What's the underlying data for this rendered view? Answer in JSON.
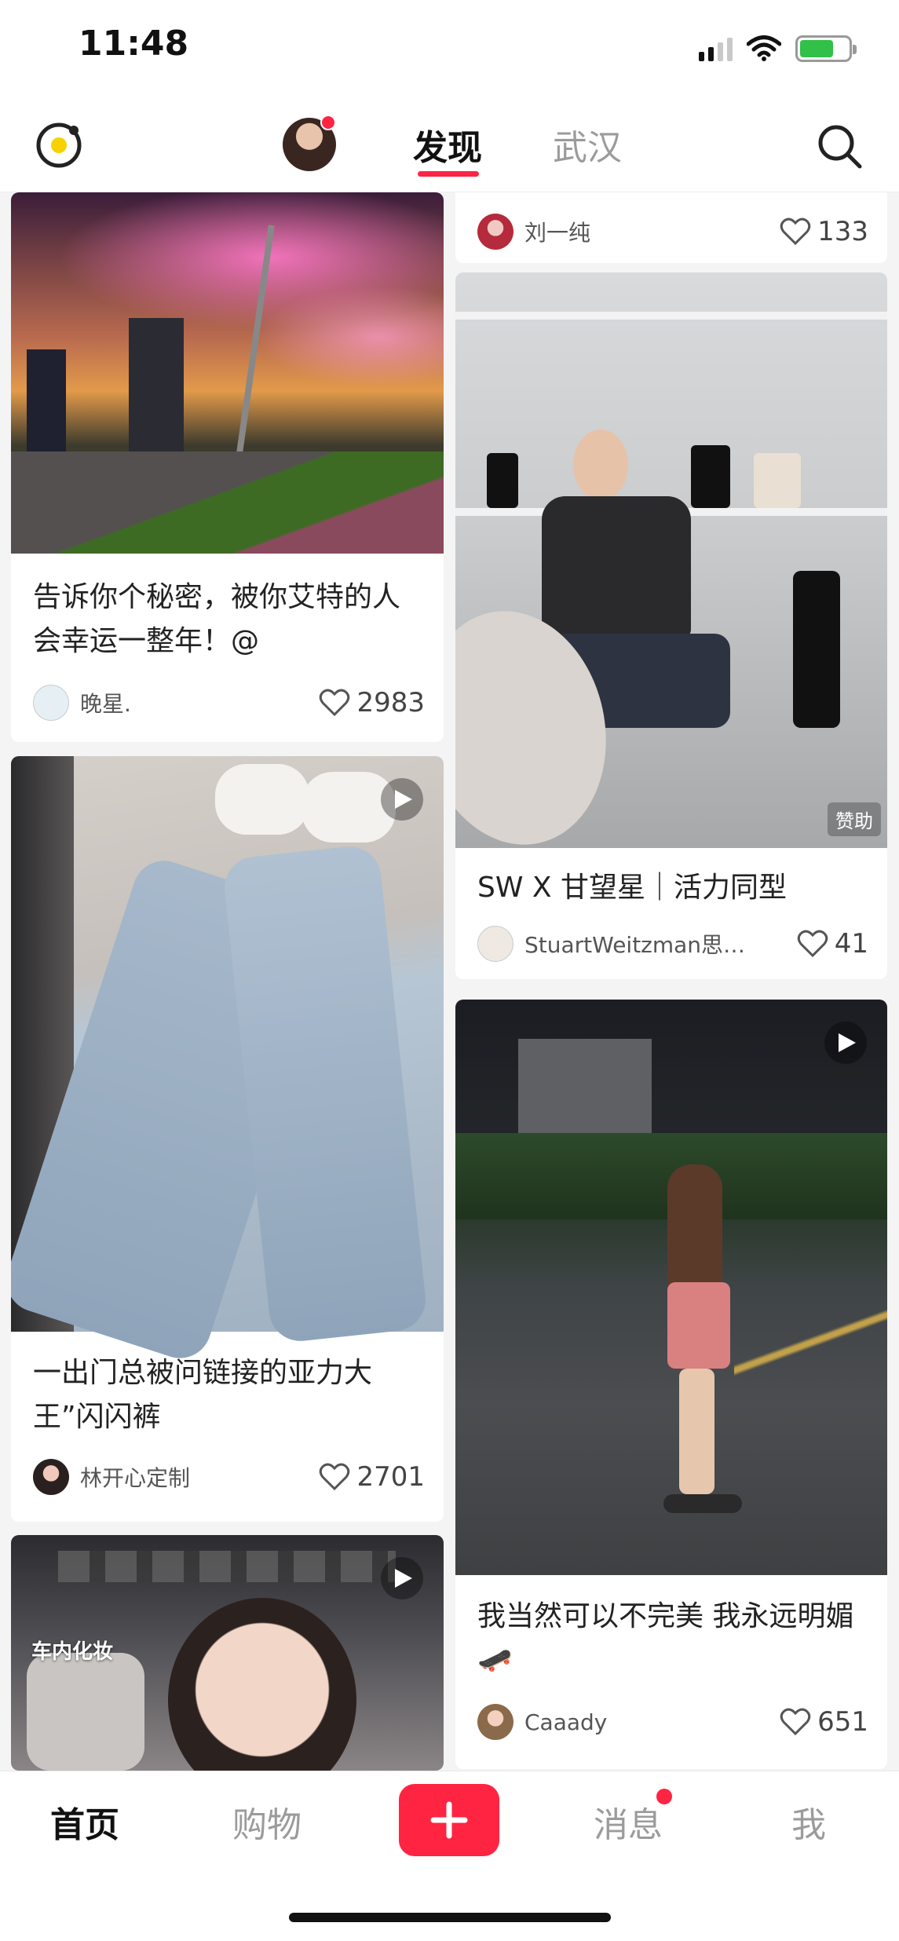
{
  "status_bar": {
    "time": "11:48"
  },
  "top_nav": {
    "tabs": [
      {
        "label": "发现",
        "active": true
      },
      {
        "label": "武汉",
        "active": false
      }
    ]
  },
  "feed": {
    "cards": [
      {
        "id": "c0",
        "title": "",
        "author": "刘一纯",
        "likes": "133"
      },
      {
        "id": "c1",
        "title": "告诉你个秘密，被你艾特的人会幸运一整年！@",
        "author": "晚星.",
        "likes": "2983"
      },
      {
        "id": "c2",
        "title": "SW X 甘望星｜活力同型",
        "author": "StuartWeitzman思…",
        "likes": "41",
        "badge": "赞助"
      },
      {
        "id": "c3",
        "title": "一出门总被问链接的亚力大王”闪闪裤",
        "author": "林开心定制",
        "likes": "2701"
      },
      {
        "id": "c4",
        "title": "我当然可以不完美 我永远明媚🛹",
        "author": "Caaady",
        "likes": "651"
      },
      {
        "id": "c5",
        "overlay_text": "车内化妆"
      }
    ]
  },
  "bottom_nav": {
    "tabs": [
      {
        "label": "首页",
        "active": true
      },
      {
        "label": "购物",
        "active": false
      },
      {
        "label": "消息",
        "active": false
      },
      {
        "label": "我",
        "active": false
      }
    ]
  },
  "colors": {
    "brand": "#ff2442",
    "text": "#222222",
    "muted": "#9b9b9b"
  }
}
